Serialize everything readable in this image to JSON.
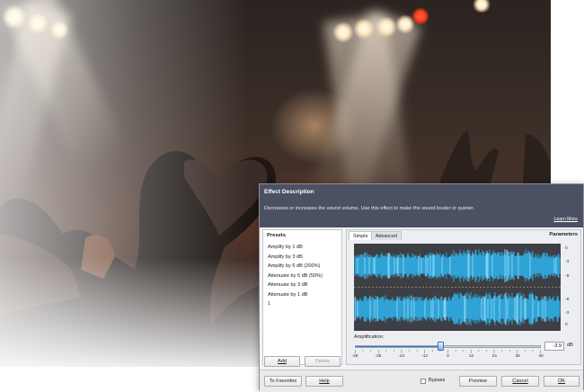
{
  "effect_description": {
    "title": "Effect Description",
    "text": "Decreases or increases the sound volume. Use this effect to make the sound louder or quieter.",
    "learn_more": "Learn More"
  },
  "presets": {
    "header": "Presets",
    "items": [
      "Amplify by 1 dB",
      "Amplify by 3 dB",
      "Amplify by 6 dB (200%)",
      "Attenuate by 6 dB (50%)",
      "Attenuate by 3 dB",
      "Attenuate by 1 dB",
      "1"
    ],
    "add_label": "Add",
    "delete_label": "Delete"
  },
  "parameters": {
    "title": "Parameters",
    "tabs": [
      "Simple",
      "Advanced"
    ],
    "active_tab": "Simple",
    "db_scale": [
      "0",
      "-3",
      "-9",
      "-9",
      "-3",
      "0"
    ],
    "amplification_label": "Amplification:",
    "amplification_value": "-3.9",
    "amplification_unit": "dB",
    "slider_min": -48,
    "slider_max": 48,
    "slider_ticks": [
      "-48",
      "-36",
      "-24",
      "-12",
      "0",
      "12",
      "24",
      "36",
      "48"
    ]
  },
  "footer": {
    "to_favorites": "To Favorites",
    "help": "Help",
    "bypass": "Bypass",
    "preview": "Preview",
    "cancel": "Cancel",
    "ok": "OK"
  },
  "colors": {
    "description_bar": "#4b5162",
    "waveform": "#2fa3d6",
    "wave_background": "#3d3f45",
    "slider_accent": "#3a7bd5"
  }
}
